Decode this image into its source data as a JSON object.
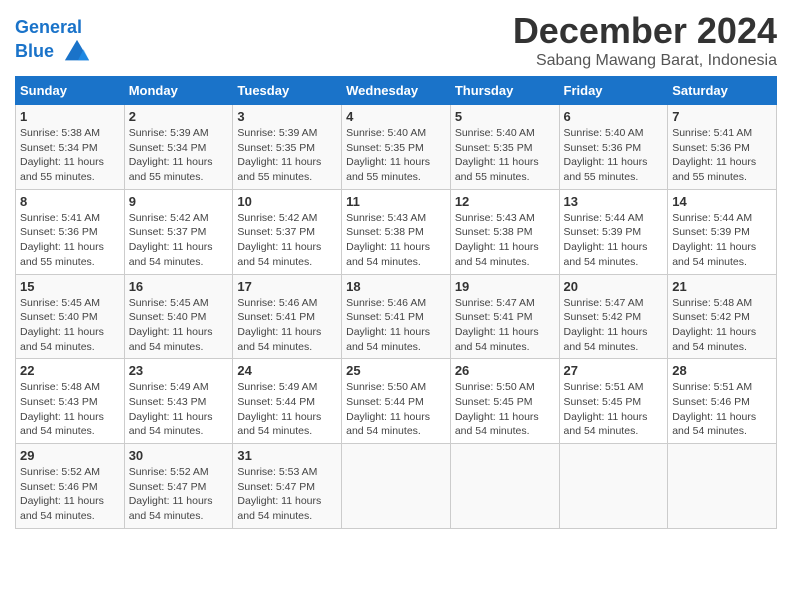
{
  "header": {
    "logo_line1": "General",
    "logo_line2": "Blue",
    "month": "December 2024",
    "location": "Sabang Mawang Barat, Indonesia"
  },
  "weekdays": [
    "Sunday",
    "Monday",
    "Tuesday",
    "Wednesday",
    "Thursday",
    "Friday",
    "Saturday"
  ],
  "weeks": [
    [
      {
        "day": "1",
        "info": "Sunrise: 5:38 AM\nSunset: 5:34 PM\nDaylight: 11 hours and 55 minutes."
      },
      {
        "day": "2",
        "info": "Sunrise: 5:39 AM\nSunset: 5:34 PM\nDaylight: 11 hours and 55 minutes."
      },
      {
        "day": "3",
        "info": "Sunrise: 5:39 AM\nSunset: 5:35 PM\nDaylight: 11 hours and 55 minutes."
      },
      {
        "day": "4",
        "info": "Sunrise: 5:40 AM\nSunset: 5:35 PM\nDaylight: 11 hours and 55 minutes."
      },
      {
        "day": "5",
        "info": "Sunrise: 5:40 AM\nSunset: 5:35 PM\nDaylight: 11 hours and 55 minutes."
      },
      {
        "day": "6",
        "info": "Sunrise: 5:40 AM\nSunset: 5:36 PM\nDaylight: 11 hours and 55 minutes."
      },
      {
        "day": "7",
        "info": "Sunrise: 5:41 AM\nSunset: 5:36 PM\nDaylight: 11 hours and 55 minutes."
      }
    ],
    [
      {
        "day": "8",
        "info": "Sunrise: 5:41 AM\nSunset: 5:36 PM\nDaylight: 11 hours and 55 minutes."
      },
      {
        "day": "9",
        "info": "Sunrise: 5:42 AM\nSunset: 5:37 PM\nDaylight: 11 hours and 54 minutes."
      },
      {
        "day": "10",
        "info": "Sunrise: 5:42 AM\nSunset: 5:37 PM\nDaylight: 11 hours and 54 minutes."
      },
      {
        "day": "11",
        "info": "Sunrise: 5:43 AM\nSunset: 5:38 PM\nDaylight: 11 hours and 54 minutes."
      },
      {
        "day": "12",
        "info": "Sunrise: 5:43 AM\nSunset: 5:38 PM\nDaylight: 11 hours and 54 minutes."
      },
      {
        "day": "13",
        "info": "Sunrise: 5:44 AM\nSunset: 5:39 PM\nDaylight: 11 hours and 54 minutes."
      },
      {
        "day": "14",
        "info": "Sunrise: 5:44 AM\nSunset: 5:39 PM\nDaylight: 11 hours and 54 minutes."
      }
    ],
    [
      {
        "day": "15",
        "info": "Sunrise: 5:45 AM\nSunset: 5:40 PM\nDaylight: 11 hours and 54 minutes."
      },
      {
        "day": "16",
        "info": "Sunrise: 5:45 AM\nSunset: 5:40 PM\nDaylight: 11 hours and 54 minutes."
      },
      {
        "day": "17",
        "info": "Sunrise: 5:46 AM\nSunset: 5:41 PM\nDaylight: 11 hours and 54 minutes."
      },
      {
        "day": "18",
        "info": "Sunrise: 5:46 AM\nSunset: 5:41 PM\nDaylight: 11 hours and 54 minutes."
      },
      {
        "day": "19",
        "info": "Sunrise: 5:47 AM\nSunset: 5:41 PM\nDaylight: 11 hours and 54 minutes."
      },
      {
        "day": "20",
        "info": "Sunrise: 5:47 AM\nSunset: 5:42 PM\nDaylight: 11 hours and 54 minutes."
      },
      {
        "day": "21",
        "info": "Sunrise: 5:48 AM\nSunset: 5:42 PM\nDaylight: 11 hours and 54 minutes."
      }
    ],
    [
      {
        "day": "22",
        "info": "Sunrise: 5:48 AM\nSunset: 5:43 PM\nDaylight: 11 hours and 54 minutes."
      },
      {
        "day": "23",
        "info": "Sunrise: 5:49 AM\nSunset: 5:43 PM\nDaylight: 11 hours and 54 minutes."
      },
      {
        "day": "24",
        "info": "Sunrise: 5:49 AM\nSunset: 5:44 PM\nDaylight: 11 hours and 54 minutes."
      },
      {
        "day": "25",
        "info": "Sunrise: 5:50 AM\nSunset: 5:44 PM\nDaylight: 11 hours and 54 minutes."
      },
      {
        "day": "26",
        "info": "Sunrise: 5:50 AM\nSunset: 5:45 PM\nDaylight: 11 hours and 54 minutes."
      },
      {
        "day": "27",
        "info": "Sunrise: 5:51 AM\nSunset: 5:45 PM\nDaylight: 11 hours and 54 minutes."
      },
      {
        "day": "28",
        "info": "Sunrise: 5:51 AM\nSunset: 5:46 PM\nDaylight: 11 hours and 54 minutes."
      }
    ],
    [
      {
        "day": "29",
        "info": "Sunrise: 5:52 AM\nSunset: 5:46 PM\nDaylight: 11 hours and 54 minutes."
      },
      {
        "day": "30",
        "info": "Sunrise: 5:52 AM\nSunset: 5:47 PM\nDaylight: 11 hours and 54 minutes."
      },
      {
        "day": "31",
        "info": "Sunrise: 5:53 AM\nSunset: 5:47 PM\nDaylight: 11 hours and 54 minutes."
      },
      null,
      null,
      null,
      null
    ]
  ]
}
